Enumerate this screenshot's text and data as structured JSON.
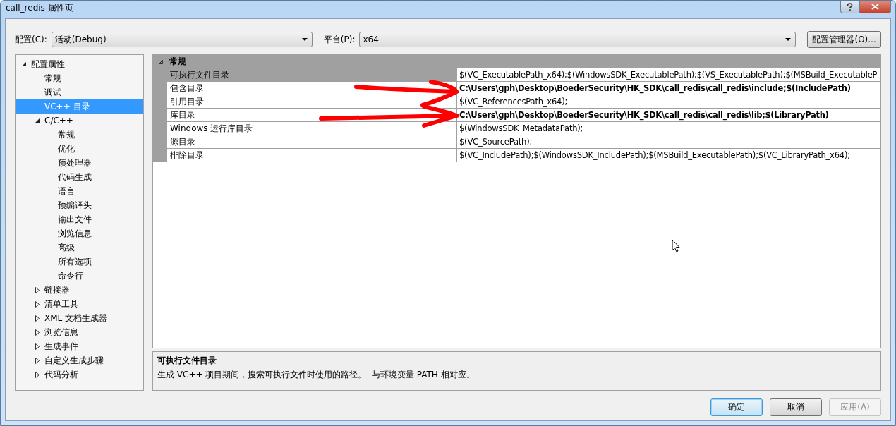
{
  "window": {
    "title": "call_redis 属性页"
  },
  "config": {
    "label": "配置(C):",
    "value": "活动(Debug)"
  },
  "platform": {
    "label": "平台(P):",
    "value": "x64"
  },
  "config_manager_button": "配置管理器(O)...",
  "tree": [
    {
      "label": "配置属性",
      "expanded": true,
      "selected": false,
      "children": [
        {
          "label": "常规",
          "selected": false
        },
        {
          "label": "调试",
          "selected": false
        },
        {
          "label": "VC++ 目录",
          "selected": true
        },
        {
          "label": "C/C++",
          "expanded": true,
          "selected": false,
          "children": [
            {
              "label": "常规",
              "selected": false
            },
            {
              "label": "优化",
              "selected": false
            },
            {
              "label": "预处理器",
              "selected": false
            },
            {
              "label": "代码生成",
              "selected": false
            },
            {
              "label": "语言",
              "selected": false
            },
            {
              "label": "预编译头",
              "selected": false
            },
            {
              "label": "输出文件",
              "selected": false
            },
            {
              "label": "浏览信息",
              "selected": false
            },
            {
              "label": "高级",
              "selected": false
            },
            {
              "label": "所有选项",
              "selected": false
            },
            {
              "label": "命令行",
              "selected": false
            }
          ]
        },
        {
          "label": "链接器",
          "expanded": false,
          "selected": false
        },
        {
          "label": "清单工具",
          "expanded": false,
          "selected": false
        },
        {
          "label": "XML 文档生成器",
          "expanded": false,
          "selected": false
        },
        {
          "label": "浏览信息",
          "expanded": false,
          "selected": false
        },
        {
          "label": "生成事件",
          "expanded": false,
          "selected": false
        },
        {
          "label": "自定义生成步骤",
          "expanded": false,
          "selected": false
        },
        {
          "label": "代码分析",
          "expanded": false,
          "selected": false
        }
      ]
    }
  ],
  "grid": {
    "category": "常规",
    "expanded": true,
    "rows": [
      {
        "name": "可执行文件目录",
        "value": "$(VC_ExecutablePath_x64);$(WindowsSDK_ExecutablePath);$(VS_ExecutablePath);$(MSBuild_ExecutableP",
        "modified": false,
        "selected": true
      },
      {
        "name": "包含目录",
        "value": "C:\\Users\\gph\\Desktop\\BoederSecurity\\HK_SDK\\call_redis\\call_redis\\include;$(IncludePath)",
        "modified": true,
        "selected": false
      },
      {
        "name": "引用目录",
        "value": "$(VC_ReferencesPath_x64);",
        "modified": false,
        "selected": false
      },
      {
        "name": "库目录",
        "value": "C:\\Users\\gph\\Desktop\\BoederSecurity\\HK_SDK\\call_redis\\call_redis\\lib;$(LibraryPath)",
        "modified": true,
        "selected": false
      },
      {
        "name": "Windows 运行库目录",
        "value": "$(WindowsSDK_MetadataPath);",
        "modified": false,
        "selected": false
      },
      {
        "name": "源目录",
        "value": "$(VC_SourcePath);",
        "modified": false,
        "selected": false
      },
      {
        "name": "排除目录",
        "value": "$(VC_IncludePath);$(WindowsSDK_IncludePath);$(MSBuild_ExecutablePath);$(VC_LibraryPath_x64);",
        "modified": false,
        "selected": false
      }
    ]
  },
  "description": {
    "title": "可执行文件目录",
    "text": "生成 VC++ 项目期间，搜索可执行文件时使用的路径。  与环境变量 PATH 相对应。"
  },
  "buttons": [
    {
      "label": "确定",
      "kind": "default",
      "disabled": false
    },
    {
      "label": "取消",
      "kind": "normal",
      "disabled": false
    },
    {
      "label": "应用(A)",
      "kind": "normal",
      "disabled": true
    }
  ]
}
